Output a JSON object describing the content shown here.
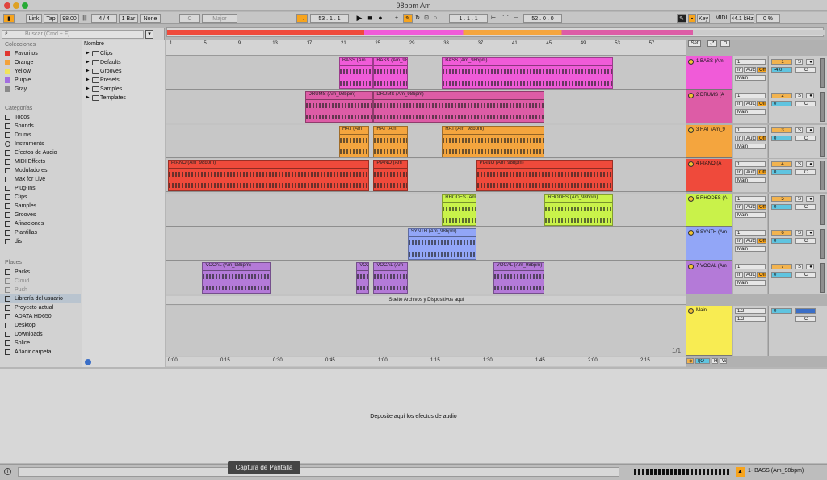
{
  "window": {
    "title": "98bpm Am"
  },
  "control_bar": {
    "link": "Link",
    "tap": "Tap",
    "tempo": "98.00",
    "signature": "4 / 4",
    "metro": "1 Bar",
    "quant": "None",
    "key": "C",
    "scale": "Major",
    "position": "53 .   1 .   1",
    "loop_start": "1 .   1 .   1",
    "loop_length": "52 .   0 .   0",
    "key_label": "Key",
    "midi_label": "MIDI",
    "sample_rate": "44.1 kHz",
    "cpu": "0 %"
  },
  "browser": {
    "search_placeholder": "Buscar (Cmd + F)",
    "collections_title": "Colecciones",
    "collections": [
      {
        "label": "Favoritos",
        "color": "#e0362f"
      },
      {
        "label": "Orange",
        "color": "#f3a23b"
      },
      {
        "label": "Yellow",
        "color": "#f1e35a"
      },
      {
        "label": "Purple",
        "color": "#a36ee0"
      },
      {
        "label": "Gray",
        "color": "#8a8a8a"
      }
    ],
    "categories_title": "Categorías",
    "categories": [
      "Todos",
      "Sounds",
      "Drums",
      "Instruments",
      "Efectos de Audio",
      "MIDI Effects",
      "Moduladores",
      "Max for Live",
      "Plug-Ins",
      "Clips",
      "Samples",
      "Grooves",
      "Afinaciones",
      "Plantillas",
      "dis"
    ],
    "places_title": "Places",
    "places": [
      "Packs",
      "Cloud",
      "Push",
      "Librería del usuario",
      "Proyecto actual",
      "ADATA HD650",
      "Desktop",
      "Downloads",
      "Splice",
      "Añadir carpeta..."
    ],
    "column_header": "Nombre",
    "items": [
      "Clips",
      "Defaults",
      "Grooves",
      "Presets",
      "Samples",
      "Templates"
    ]
  },
  "ruler": {
    "bars": [
      "1",
      "5",
      "9",
      "13",
      "17",
      "21",
      "25",
      "29",
      "33",
      "37",
      "41",
      "45",
      "49",
      "53",
      "57"
    ]
  },
  "time": {
    "labels": [
      "0:00",
      "0:15",
      "0:30",
      "0:45",
      "1:00",
      "1:15",
      "1:30",
      "1:45",
      "2:00",
      "2:15"
    ]
  },
  "tracks": [
    {
      "name": "1  BASS (Am",
      "num": "1",
      "color": "#f05bd8",
      "vol": "-4.0",
      "clips": [
        {
          "label": "BASS (Am",
          "start": 21,
          "end": 25
        },
        {
          "label": "BASS (Am_98",
          "start": 25,
          "end": 29
        },
        {
          "label": "BASS (Am_98bpm)",
          "start": 33,
          "end": 53
        }
      ]
    },
    {
      "name": "2  DRUMS (A",
      "num": "2",
      "color": "#dd5ca6",
      "vol": "0",
      "clips": [
        {
          "label": "DRUMS (Am_98bpm)",
          "start": 17,
          "end": 25
        },
        {
          "label": "DRUMS (Am_98bpm)",
          "start": 25,
          "end": 45
        }
      ]
    },
    {
      "name": "3  HAT (Am_9",
      "num": "3",
      "color": "#f4a53e",
      "vol": "0",
      "clips": [
        {
          "label": "HAT (Am",
          "start": 21,
          "end": 24.5
        },
        {
          "label": "HAT (Am",
          "start": 25,
          "end": 29
        },
        {
          "label": "HAT (Am_98bpm)",
          "start": 33,
          "end": 45
        }
      ]
    },
    {
      "name": "4  PIANO (A",
      "num": "4",
      "color": "#ef4a3b",
      "vol": "0",
      "clips": [
        {
          "label": "PIANO (Am_98bpm)",
          "start": 1,
          "end": 24.5
        },
        {
          "label": "PIANO (Am",
          "start": 25,
          "end": 29
        },
        {
          "label": "PIANO (Am_98bpm)",
          "start": 37,
          "end": 53
        }
      ]
    },
    {
      "name": "5  RHODES (A",
      "num": "5",
      "color": "#c9f24a",
      "vol": "0",
      "clips": [
        {
          "label": "RHODES (Am",
          "start": 33,
          "end": 37
        },
        {
          "label": "RHODES (Am_98bpm)",
          "start": 45,
          "end": 53
        }
      ]
    },
    {
      "name": "6  SYNTH (Am",
      "num": "6",
      "color": "#92a6f7",
      "vol": "0",
      "clips": [
        {
          "label": "SYNTH (Am_98bpm)",
          "start": 29,
          "end": 37
        }
      ]
    },
    {
      "name": "7  VOCAL (Am",
      "num": "7",
      "color": "#b47ad8",
      "vol": "0",
      "clips": [
        {
          "label": "VOCAL (Am_98bpm)",
          "start": 5,
          "end": 13
        },
        {
          "label": "VOC",
          "start": 23,
          "end": 24.5
        },
        {
          "label": "VOCAL (Am",
          "start": 25,
          "end": 29
        },
        {
          "label": "VOCAL (Am_98bpm)",
          "start": 39,
          "end": 45
        }
      ]
    }
  ],
  "io": {
    "input": "1",
    "monitor_in": "In",
    "monitor_auto": "Auto",
    "monitor_off": "Off",
    "output": "Main",
    "sends": "S",
    "c": "C"
  },
  "drop_hint": "Suelte Archivos y Dispositivos aquí",
  "master": {
    "name": "Main",
    "out1": "1/2",
    "out2": "1/2",
    "vol": "0",
    "c": "C"
  },
  "page_counter": "1/1",
  "master_buttons": {
    "io": "I|O",
    "h": "H",
    "w": "W"
  },
  "device_drop": "Deposite aquí los efectos de audio",
  "tooltip": "Captura de Pantalla",
  "status": {
    "selected": "1- BASS (Am_98bpm)"
  },
  "set_label": "Set"
}
